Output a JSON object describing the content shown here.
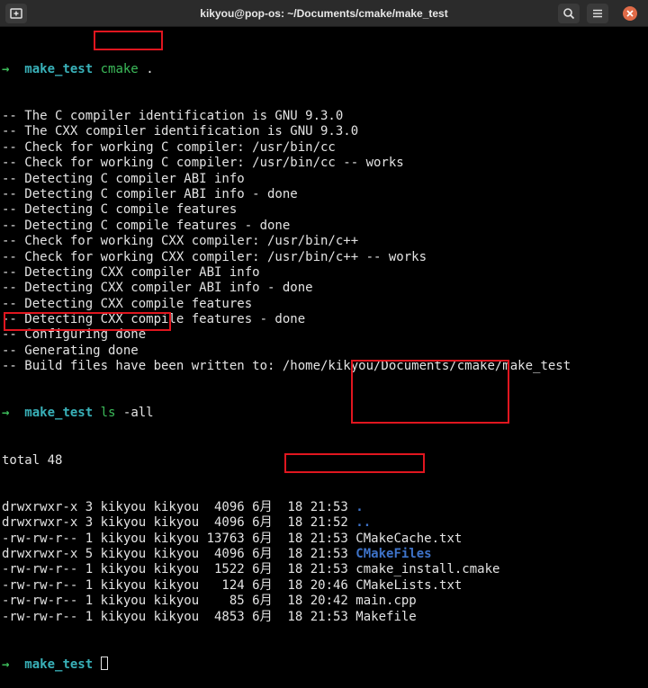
{
  "window": {
    "title": "kikyou@pop-os: ~/Documents/cmake/make_test"
  },
  "terminal": {
    "prompt_arrow": "→",
    "prompt_dir": "make_test",
    "cmd1": {
      "name": "cmake",
      "args": "."
    },
    "cmake_output": [
      "-- The C compiler identification is GNU 9.3.0",
      "-- The CXX compiler identification is GNU 9.3.0",
      "-- Check for working C compiler: /usr/bin/cc",
      "-- Check for working C compiler: /usr/bin/cc -- works",
      "-- Detecting C compiler ABI info",
      "-- Detecting C compiler ABI info - done",
      "-- Detecting C compile features",
      "-- Detecting C compile features - done",
      "-- Check for working CXX compiler: /usr/bin/c++",
      "-- Check for working CXX compiler: /usr/bin/c++ -- works",
      "-- Detecting CXX compiler ABI info",
      "-- Detecting CXX compiler ABI info - done",
      "-- Detecting CXX compile features",
      "-- Detecting CXX compile features - done",
      "-- Configuring done",
      "-- Generating done",
      "-- Build files have been written to: /home/kikyou/Documents/cmake/make_test"
    ],
    "cmd2": {
      "name": "ls",
      "args": "-all"
    },
    "ls_total": "total 48",
    "ls_entries": [
      {
        "meta": "drwxrwxr-x 3 kikyou kikyou  4096 6月  18 21:53 ",
        "name": ".",
        "blue": true
      },
      {
        "meta": "drwxrwxr-x 3 kikyou kikyou  4096 6月  18 21:52 ",
        "name": "..",
        "blue": true
      },
      {
        "meta": "-rw-rw-r-- 1 kikyou kikyou 13763 6月  18 21:53 ",
        "name": "CMakeCache.txt",
        "blue": false
      },
      {
        "meta": "drwxrwxr-x 5 kikyou kikyou  4096 6月  18 21:53 ",
        "name": "CMakeFiles",
        "blue": true
      },
      {
        "meta": "-rw-rw-r-- 1 kikyou kikyou  1522 6月  18 21:53 ",
        "name": "cmake_install.cmake",
        "blue": false
      },
      {
        "meta": "-rw-rw-r-- 1 kikyou kikyou   124 6月  18 20:46 ",
        "name": "CMakeLists.txt",
        "blue": false
      },
      {
        "meta": "-rw-rw-r-- 1 kikyou kikyou    85 6月  18 20:42 ",
        "name": "main.cpp",
        "blue": false
      },
      {
        "meta": "-rw-rw-r-- 1 kikyou kikyou  4853 6月  18 21:53 ",
        "name": "Makefile",
        "blue": false
      }
    ]
  },
  "colors": {
    "background": "#000000",
    "prompt_arrow": "#3cbb5a",
    "prompt_dir": "#39b1b9",
    "directory_entry": "#3e73c9",
    "highlight_box": "#e0161f"
  },
  "icons": {
    "new_tab": "new-tab-icon",
    "search": "search-icon",
    "menu": "hamburger-menu-icon",
    "close": "close-icon"
  }
}
